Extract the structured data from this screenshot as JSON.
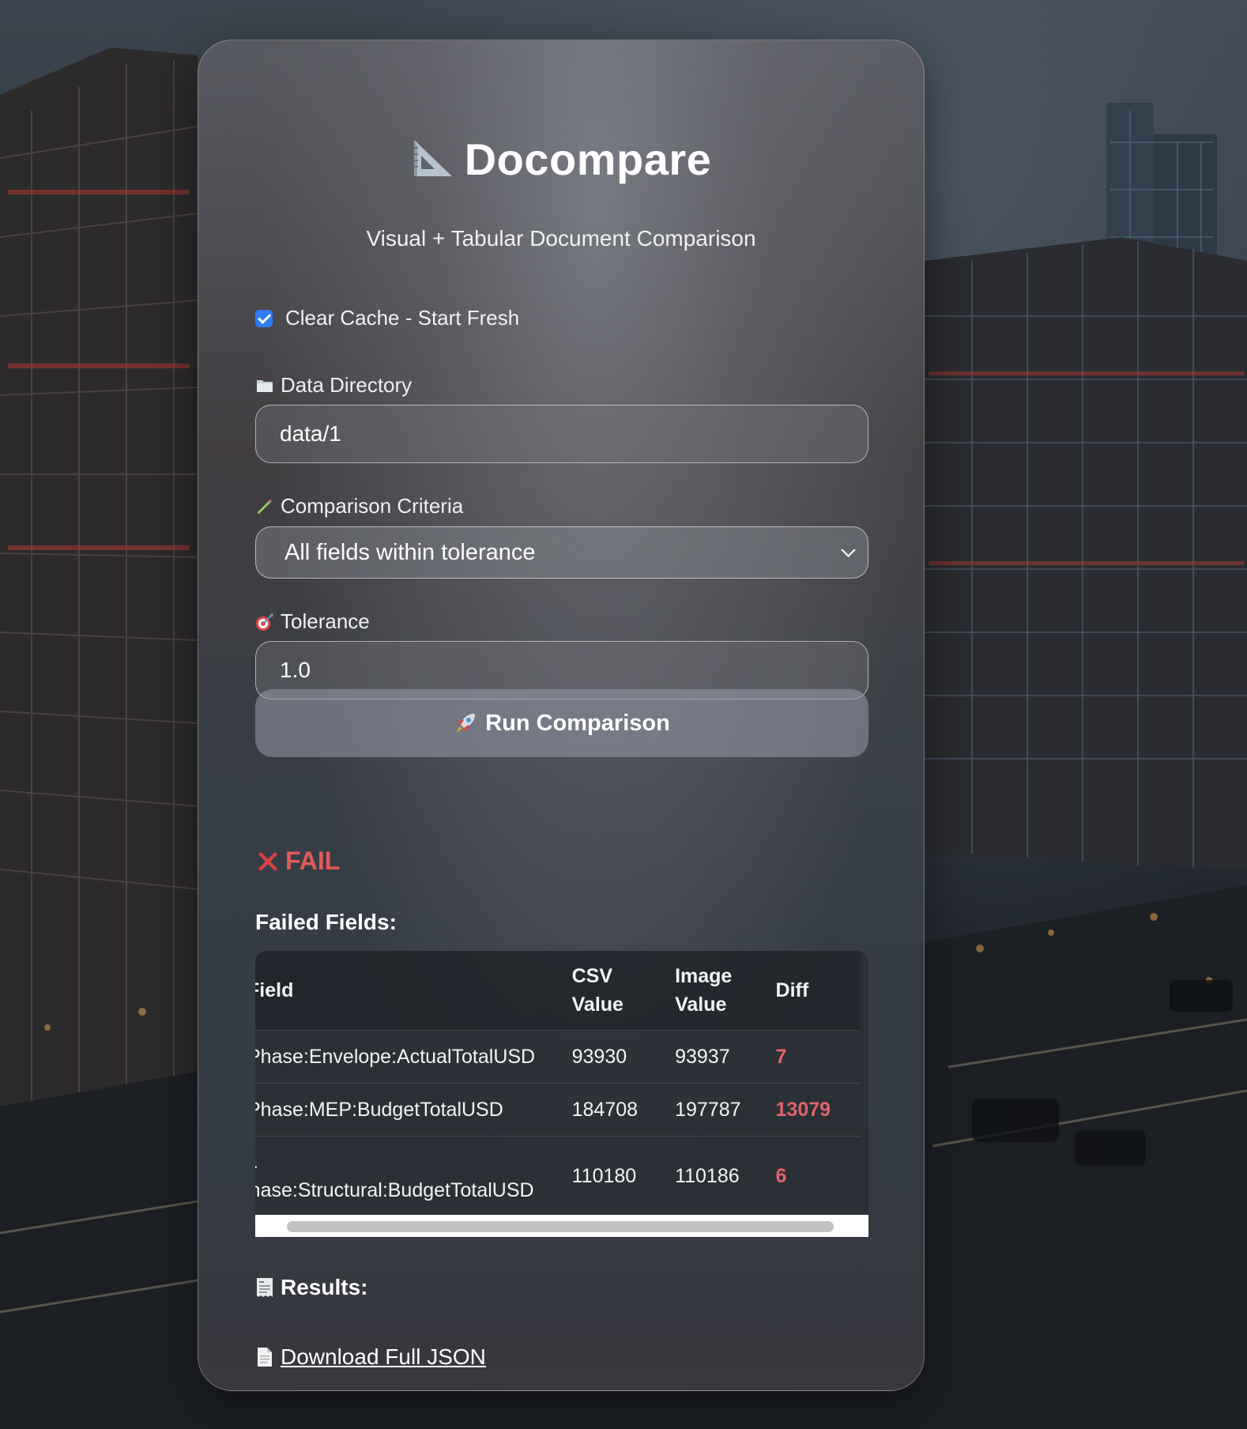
{
  "app": {
    "title": "Docompare",
    "subtitle": "Visual + Tabular Document Comparison"
  },
  "options": {
    "clear_cache_label": "Clear Cache - Start Fresh",
    "clear_cache_checked": true
  },
  "data_directory": {
    "label": "Data Directory",
    "value": "data/1",
    "icon": "folder-icon"
  },
  "criteria": {
    "label": "Comparison Criteria",
    "selected": "All fields within tolerance",
    "icon": "pencil-icon"
  },
  "tolerance": {
    "label": "Tolerance",
    "value": "1.0",
    "icon": "target-icon"
  },
  "run_button": {
    "label": "Run Comparison",
    "icon": "rocket-icon"
  },
  "status": {
    "text": "FAIL",
    "icon": "cross-mark-icon",
    "color": "#e2595a"
  },
  "failed_fields": {
    "title": "Failed Fields:",
    "columns": [
      {
        "line1": "Field",
        "line2": ""
      },
      {
        "line1": "CSV",
        "line2": "Value"
      },
      {
        "line1": "Image",
        "line2": "Value"
      },
      {
        "line1": "Diff",
        "line2": ""
      }
    ],
    "rows": [
      {
        "field": "Phase:Envelope:ActualTotalUSD",
        "field_prefix": "",
        "csv": "93930",
        "image": "93937",
        "diff": "7"
      },
      {
        "field": "Phase:MEP:BudgetTotalUSD",
        "field_prefix": "",
        "csv": "184708",
        "image": "197787",
        "diff": "13079"
      },
      {
        "field": "Phase:Structural:BudgetTotalUSD",
        "field_prefix": "..",
        "csv": "110180",
        "image": "110186",
        "diff": "6"
      }
    ]
  },
  "results": {
    "title": "Results:",
    "download_label": "Download Full JSON",
    "icon": "receipt-icon",
    "download_icon": "page-icon"
  },
  "colors": {
    "accent": "#2f7cf6",
    "fail": "#e2595a"
  }
}
